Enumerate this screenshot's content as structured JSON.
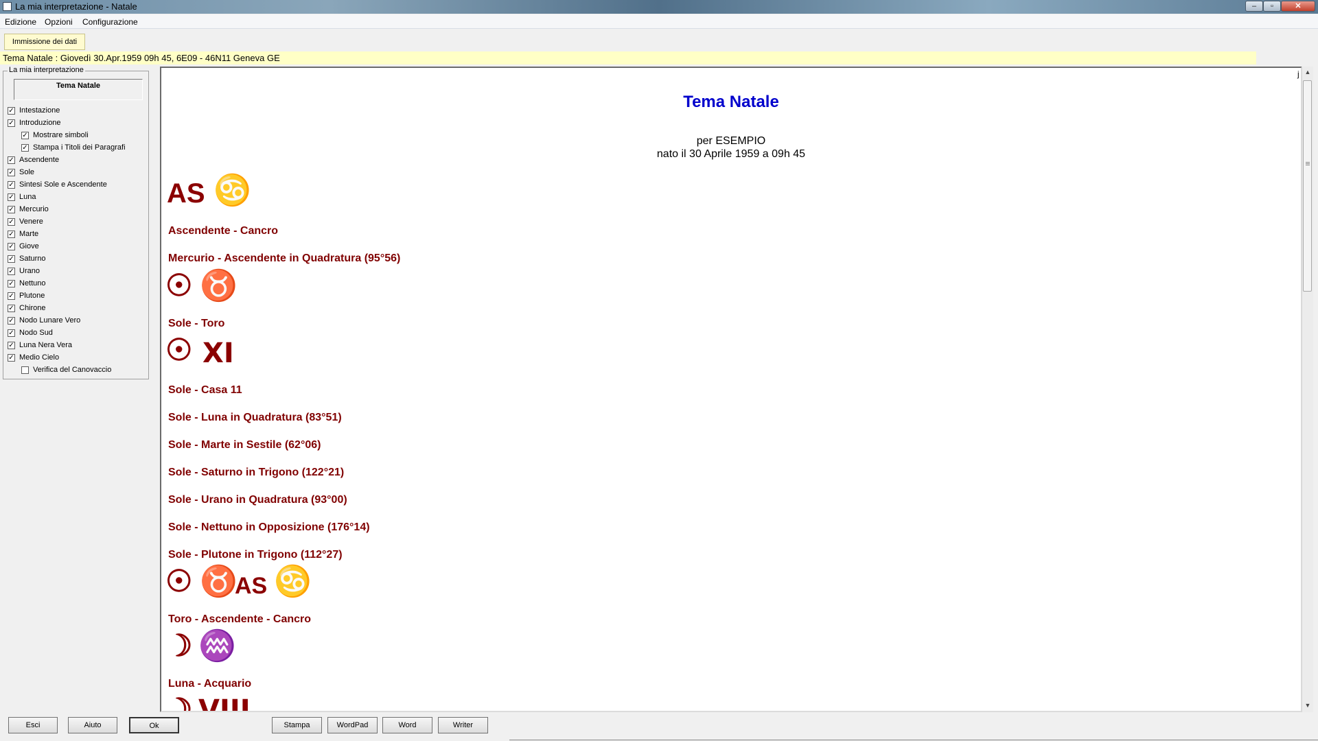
{
  "window": {
    "title": "La mia interpretazione - Natale",
    "minimize": "–",
    "maximize": "▫",
    "close": "✕"
  },
  "menu": [
    "Edizione",
    "Opzioni",
    "Configurazione"
  ],
  "tab": {
    "label": "Immissione dei dati"
  },
  "info": "Tema Natale : Giovedì 30.Apr.1959 09h 45, 6E09 - 46N11  Geneva GE",
  "sidebar": {
    "legend": "La mia interpretazione",
    "selection": "Tema Natale",
    "options": [
      {
        "label": "Intestazione",
        "checked": true,
        "indent": 0
      },
      {
        "label": "Introduzione",
        "checked": true,
        "indent": 0
      },
      {
        "label": "Mostrare simboli",
        "checked": true,
        "indent": 1
      },
      {
        "label": "Stampa i Titoli dei Paragrafi",
        "checked": true,
        "indent": 1
      },
      {
        "label": "Ascendente",
        "checked": true,
        "indent": 0
      },
      {
        "label": "Sole",
        "checked": true,
        "indent": 0
      },
      {
        "label": "Sintesi Sole e Ascendente",
        "checked": true,
        "indent": 0
      },
      {
        "label": "Luna",
        "checked": true,
        "indent": 0
      },
      {
        "label": "Mercurio",
        "checked": true,
        "indent": 0
      },
      {
        "label": "Venere",
        "checked": true,
        "indent": 0
      },
      {
        "label": "Marte",
        "checked": true,
        "indent": 0
      },
      {
        "label": "Giove",
        "checked": true,
        "indent": 0
      },
      {
        "label": "Saturno",
        "checked": true,
        "indent": 0
      },
      {
        "label": "Urano",
        "checked": true,
        "indent": 0
      },
      {
        "label": "Nettuno",
        "checked": true,
        "indent": 0
      },
      {
        "label": "Plutone",
        "checked": true,
        "indent": 0
      },
      {
        "label": "Chirone",
        "checked": true,
        "indent": 0
      },
      {
        "label": "Nodo Lunare Vero",
        "checked": true,
        "indent": 0
      },
      {
        "label": "Nodo Sud",
        "checked": true,
        "indent": 0
      },
      {
        "label": "Luna Nera Vera",
        "checked": true,
        "indent": 0
      },
      {
        "label": "Medio Cielo",
        "checked": true,
        "indent": 0
      },
      {
        "label": "Verifica del Canovaccio",
        "checked": false,
        "indent": 1
      }
    ]
  },
  "document": {
    "title": "Tema Natale",
    "subtitle1": "per ESEMPIO",
    "subtitle2": "nato il 30 Aprile 1959 a 09h 45",
    "corner": "j",
    "symbols": {
      "as_cancer": {
        "as": "AS",
        "sign": "♋"
      },
      "sun_taurus": {
        "sun": "☉",
        "sign": "♉"
      },
      "sun_house": {
        "sun": "☉",
        "house": "XI"
      },
      "sun_taurus_as_cancer": {
        "sun": "☉",
        "taurus": "♉",
        "as": "AS",
        "cancer": "♋"
      },
      "moon_aquarius": {
        "moon": "☽",
        "sign": "♒"
      },
      "moon_house": {
        "moon": "☽",
        "house": "VIII"
      }
    },
    "headings": [
      "Ascendente - Cancro",
      "Mercurio - Ascendente in Quadratura (95°56)",
      "Sole - Toro",
      "Sole - Casa 11",
      "Sole - Luna in Quadratura (83°51)",
      "Sole - Marte in Sestile (62°06)",
      "Sole - Saturno in Trigono (122°21)",
      "Sole - Urano in Quadratura (93°00)",
      "Sole - Nettuno in Opposizione (176°14)",
      "Sole - Plutone in Trigono (112°27)",
      "Toro - Ascendente - Cancro",
      "Luna - Acquario"
    ]
  },
  "scrollbar": {
    "up": "▲",
    "down": "▼"
  },
  "buttons": {
    "esci": "Esci",
    "aiuto": "Aiuto",
    "ok": "Ok",
    "stampa": "Stampa",
    "wordpad": "WordPad",
    "word": "Word",
    "writer": "Writer"
  }
}
